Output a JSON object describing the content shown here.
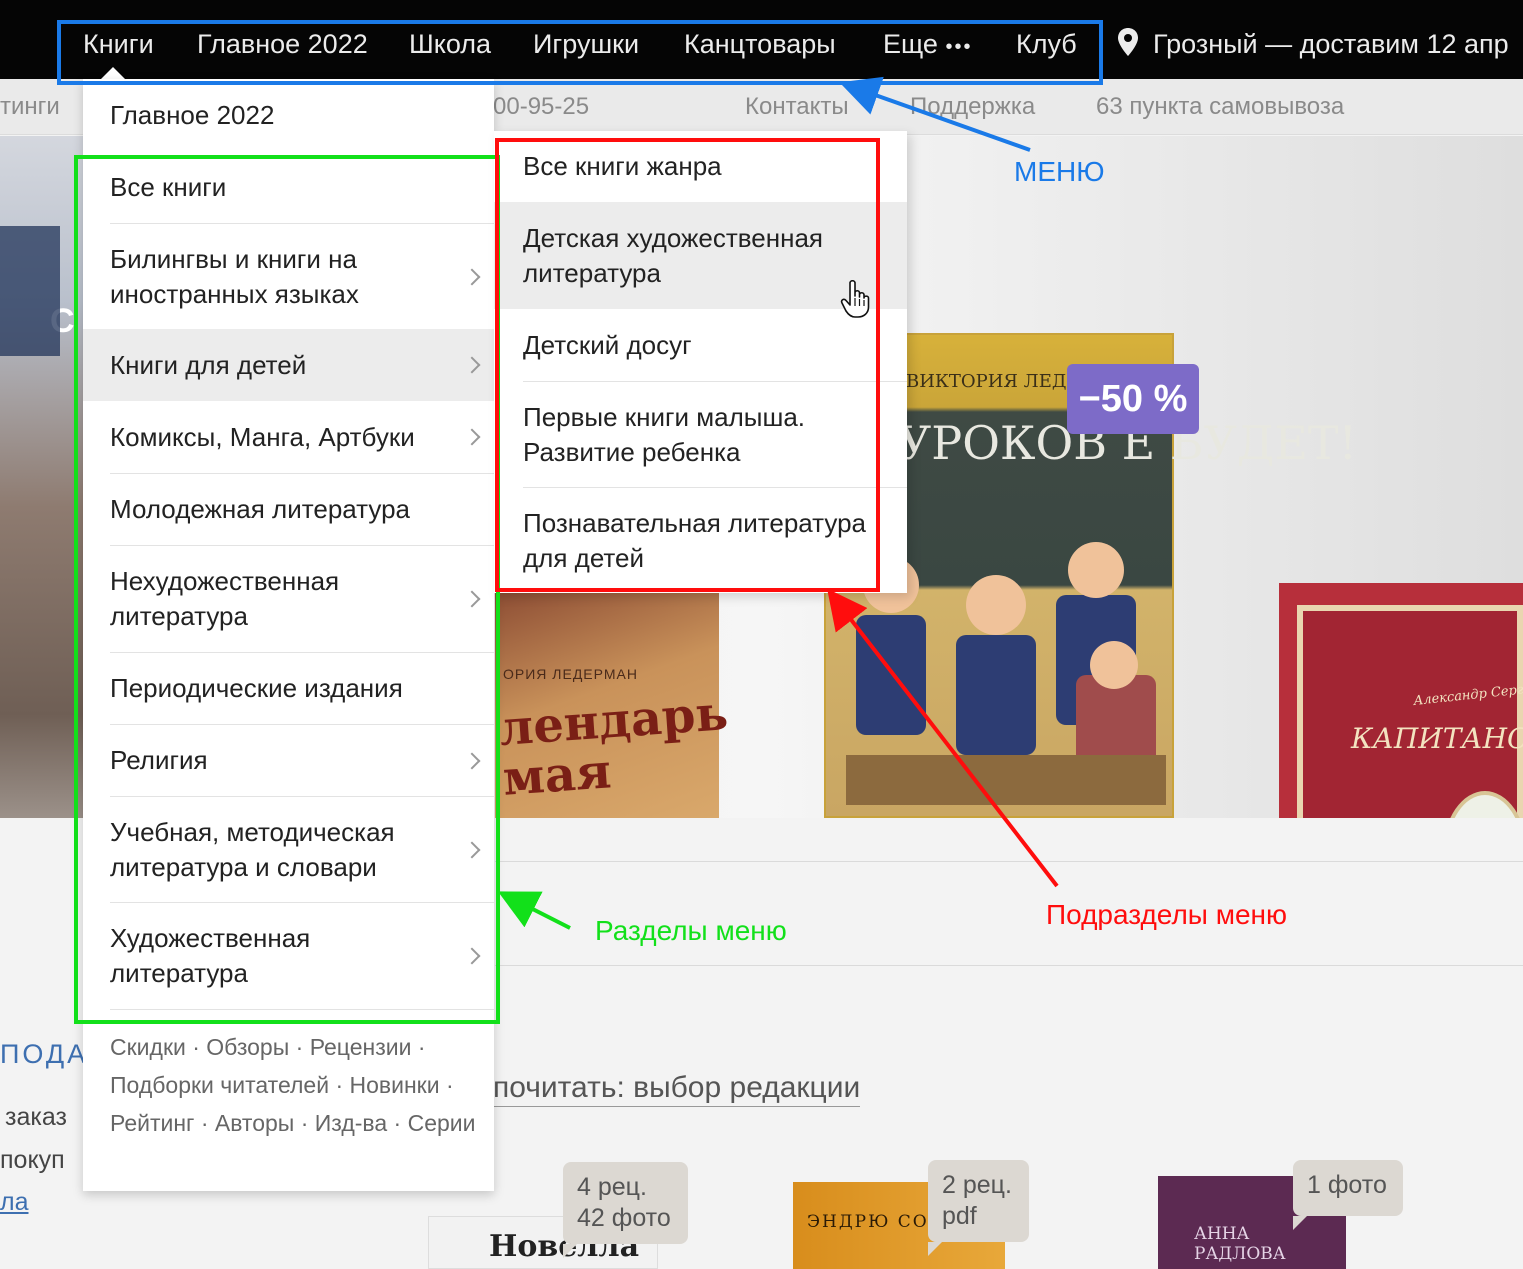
{
  "nav": {
    "items": [
      "Книги",
      "Главное 2022",
      "Школа",
      "Игрушки",
      "Канцтовары",
      "Еще",
      "Клуб"
    ],
    "more_dots": "•••",
    "location": "Грозный — доставим 12 апр"
  },
  "subbar": {
    "fragment_left": "тинги",
    "phone_fragment": "00-95-25",
    "contacts": "Контакты",
    "support": "Поддержка",
    "pickup": "63 пункта самовывоза"
  },
  "dropdown": {
    "top_item": "Главное 2022",
    "sections": [
      {
        "label": "Все книги",
        "has_children": false
      },
      {
        "label": "Билингвы и книги на иностранных языках",
        "has_children": true
      },
      {
        "label": "Книги для детей",
        "has_children": true,
        "hovered": true
      },
      {
        "label": "Комиксы, Манга, Артбуки",
        "has_children": true
      },
      {
        "label": "Молодежная литература",
        "has_children": false
      },
      {
        "label": "Нехудожественная литература",
        "has_children": true
      },
      {
        "label": "Периодические издания",
        "has_children": false
      },
      {
        "label": "Религия",
        "has_children": true
      },
      {
        "label": "Учебная, методическая литература и словари",
        "has_children": true
      },
      {
        "label": "Художественная литература",
        "has_children": true
      }
    ],
    "footer": "Скидки · Обзоры · Рецензии · Подборки читателей · Новинки · Рейтинг · Авторы · Изд-ва · Серии"
  },
  "subdropdown": {
    "items": [
      {
        "label": "Все книги жанра"
      },
      {
        "label": "Детская художественная литература",
        "hovered": true
      },
      {
        "label": "Детский досуг"
      },
      {
        "label": "Первые книги малыша. Развитие ребенка"
      },
      {
        "label": "Познавательная литература для детей"
      }
    ]
  },
  "hero": {
    "discount": "−50 %",
    "book1_author": "ОРИЯ ЛЕДЕРМАН",
    "book1_title": "лендарь мая",
    "book2_author": "ВИКТОРИЯ ЛЕДЕРМАН",
    "book2_title": "УРОКОВ Е БУДЕТ!",
    "book3_author": "Александр Сергеевич Пушкин",
    "book3_title": "КАПИТАНСК ДОЧКА",
    "left_fragment": "С"
  },
  "lower": {
    "left_heading_fragment": "ПОДА",
    "left_text_1": "заказ",
    "left_text_2": "покуп",
    "left_link": "ла",
    "editors_choice": "почитать: выбор редакции",
    "tag1": "4 рец. 42 фото",
    "tag2": "2 рец. pdf",
    "tag3": "1 фото",
    "cover1_title": "Новелла",
    "cover2_title": "ЭНДРЮ СО",
    "cover3_title": "АННА РАДЛОВА"
  },
  "annotations": {
    "menu": "МЕНЮ",
    "sections": "Разделы меню",
    "subsections": "Подразделы меню",
    "colors": {
      "menu": "#1a7ae8",
      "sections": "#12e01a",
      "subsections": "#ff0d0d"
    }
  },
  "icons": [
    "location-pin-icon",
    "chevron-right-icon",
    "hand-cursor-icon",
    "more-dots-icon"
  ]
}
